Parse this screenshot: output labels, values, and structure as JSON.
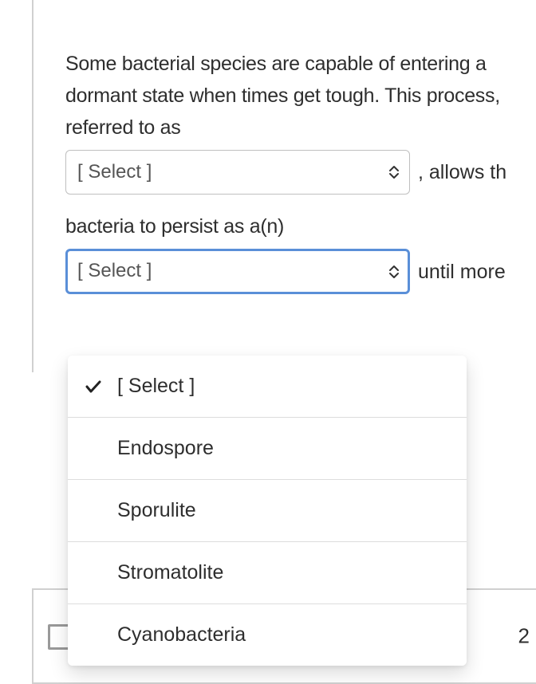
{
  "question": {
    "text_part1": "Some bacterial species are capable of entering a dormant state when times get tough. This process, referred to as",
    "text_part2": ", allows th",
    "text_part3": "bacteria to persist as a(n)",
    "text_part4": "until more",
    "text_hidden": ""
  },
  "select1": {
    "label": "[ Select ]"
  },
  "select2": {
    "label": "[ Select ]"
  },
  "dropdown": {
    "items": [
      "[ Select ]",
      "Endospore",
      "Sporulite",
      "Stromatolite",
      "Cyanobacteria"
    ]
  },
  "footer": {
    "number": "2"
  }
}
